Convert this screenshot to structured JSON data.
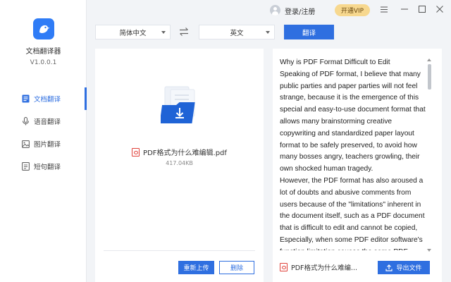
{
  "sidebar": {
    "app_name": "文档翻译器",
    "version": "V1.0.0.1",
    "items": [
      {
        "label": "文档翻译",
        "icon": "document-icon",
        "active": true
      },
      {
        "label": "语音翻译",
        "icon": "microphone-icon",
        "active": false
      },
      {
        "label": "图片翻译",
        "icon": "image-icon",
        "active": false
      },
      {
        "label": "短句翻译",
        "icon": "text-icon",
        "active": false
      }
    ]
  },
  "topbar": {
    "login_label": "登录/注册",
    "vip_label": "开通VIP"
  },
  "language_bar": {
    "source_language": "简体中文",
    "target_language": "英文",
    "translate_label": "翻译"
  },
  "source_panel": {
    "file_name": "PDF格式为什么难编辑.pdf",
    "file_size": "417.04KB",
    "reupload_label": "重新上传",
    "delete_label": "删除"
  },
  "result_panel": {
    "paragraphs": [
      "Why is PDF Format Difficult to Edit",
      "Speaking of PDF format, I believe that many public parties and paper parties will not feel strange, because it is the emergence of this special and easy-to-use document format that allows many brainstorming creative copywriting and standardized paper layout format to be safely preserved, to avoid how many bosses angry, teachers growling, their own shocked human tragedy.",
      "However, the PDF format has also aroused a lot of doubts and abusive comments from users because of the \"limitations\" inherent in the document itself, such as a PDF document that is difficult to edit and cannot be copied,",
      "Especially, when some PDF editor software's function limitation causes the same PDF"
    ],
    "output_file": "PDF格式为什么难编...",
    "export_label": "导出文件"
  },
  "colors": {
    "accent": "#2f6fe0",
    "vip": "#f7d88f",
    "pdf_red": "#e0413a",
    "background": "#f2f4f7"
  }
}
